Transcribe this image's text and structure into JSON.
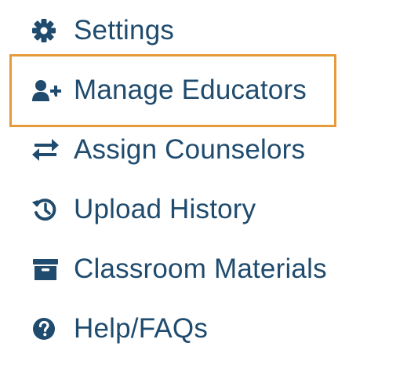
{
  "menu": {
    "items": [
      {
        "label": "Settings",
        "icon": "gear-icon"
      },
      {
        "label": "Manage Educators",
        "icon": "user-plus-icon"
      },
      {
        "label": "Assign Counselors",
        "icon": "swap-arrows-icon"
      },
      {
        "label": "Upload History",
        "icon": "history-icon"
      },
      {
        "label": "Classroom Materials",
        "icon": "archive-box-icon"
      },
      {
        "label": "Help/FAQs",
        "icon": "question-circle-icon"
      }
    ],
    "highlighted_item": "Manage Educators"
  },
  "colors": {
    "text": "#1f4b6e",
    "icon": "#1f4b6e",
    "highlight_border": "#e69a3a",
    "background": "#ffffff"
  }
}
